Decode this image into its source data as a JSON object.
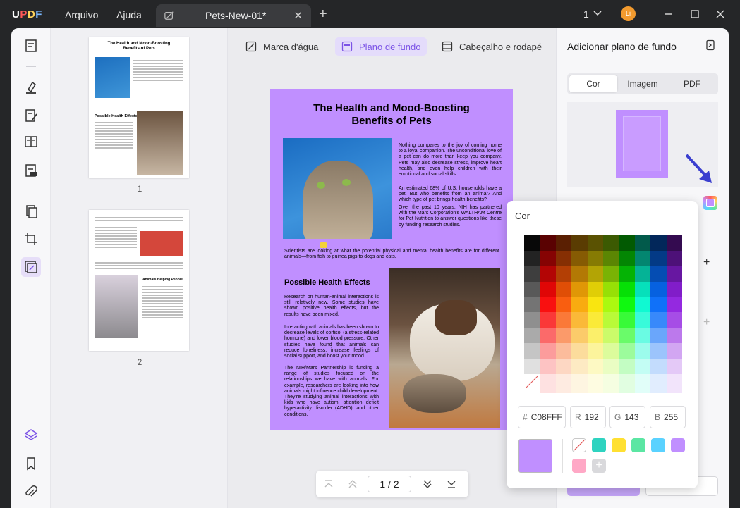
{
  "titlebar": {
    "logo": [
      "U",
      "P",
      "D",
      "F"
    ],
    "menu": [
      "Arquivo",
      "Ajuda"
    ],
    "tab_title": "Pets-New-01*",
    "tab_close": "✕",
    "new_tab": "+",
    "page_count": "1",
    "avatar": "Li"
  },
  "thumbnails": {
    "page1_title": "The Health and Mood-Boosting Benefits of Pets",
    "page1_heading": "Possible Health Effects",
    "page2_heading": "Animals Helping People",
    "labels": [
      "1",
      "2"
    ]
  },
  "subtabs": [
    "Marca d'água",
    "Plano de fundo",
    "Cabeçalho e rodapé"
  ],
  "document": {
    "title_line1": "The Health and Mood-Boosting",
    "title_line2": "Benefits of Pets",
    "para1": "Nothing compares to the joy of coming home to a loyal companion. The unconditional love of a pet can do more than keep you company. Pets may also decrease stress, improve heart health, and even help children with their emotional and social skills.",
    "para2": "An estimated 68% of U.S. households have a pet. But who benefits from an animal? And which type of pet brings health benefits?",
    "para3": "Over the past 10 years, NIH has partnered with the Mars Corporation's WALTHAM Centre for Pet Nutrition to answer questions like these by funding research studies.",
    "caption": "Scientists are looking at what the potential physical and mental health benefits are for different animals—from fish to guinea pigs to dogs and cats.",
    "heading2": "Possible Health Effects",
    "para4": "Research on human-animal interactions is still relatively new. Some studies have shown positive health effects, but the results have been mixed.",
    "para5": "Interacting with animals has been shown to decrease levels of cortisol (a stress-related hormone) and lower blood pressure. Other studies have found that animals can reduce loneliness, increase feelings of social support, and boost your mood.",
    "para6": "The NIH/Mars Partnership is funding a range of studies focused on the relationships we have with animals. For example, researchers are looking into how animals might influence child development. They're studying animal interactions with kids who have autism, attention deficit hyperactivity disorder (ADHD), and other conditions."
  },
  "pager": {
    "current": "1",
    "separator": "/",
    "total": "2"
  },
  "right_panel": {
    "title": "Adicionar plano de fundo",
    "segments": [
      "Cor",
      "Imagem",
      "PDF"
    ]
  },
  "color_popup": {
    "title": "Cor",
    "hex_label": "#",
    "hex": "C08FFF",
    "r_label": "R",
    "r": "192",
    "g_label": "G",
    "g": "143",
    "b_label": "B",
    "b": "255",
    "selected_color": "#C08FFF",
    "recent": [
      "#2ED3C0",
      "#FFE032",
      "#5BE6A3",
      "#5AD2FF",
      "#C08FFF",
      "#FFA8C6"
    ]
  }
}
